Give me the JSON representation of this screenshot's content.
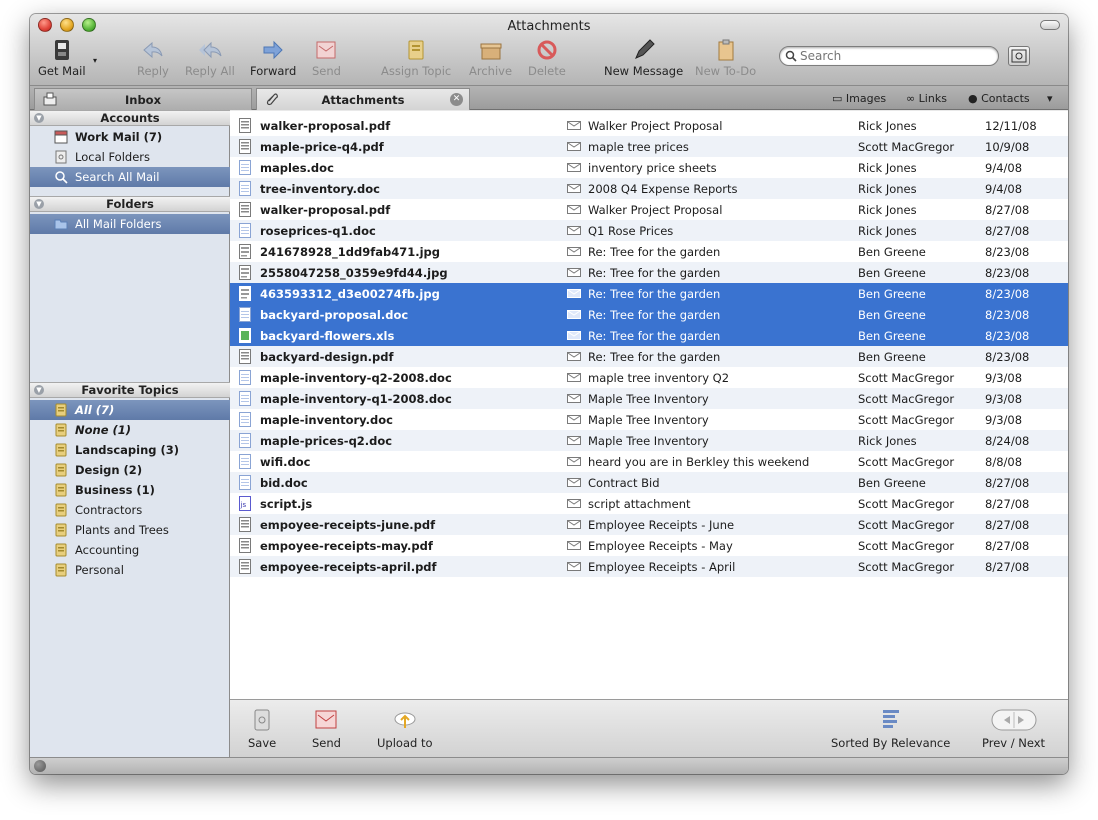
{
  "window": {
    "title": "Attachments"
  },
  "toolbar": {
    "get_mail": "Get Mail",
    "reply": "Reply",
    "reply_all": "Reply All",
    "forward": "Forward",
    "send": "Send",
    "assign_topic": "Assign Topic",
    "archive": "Archive",
    "delete": "Delete",
    "new_message": "New Message",
    "new_todo": "New To-Do",
    "search_placeholder": "Search"
  },
  "tabs": {
    "inbox": "Inbox",
    "attachments": "Attachments",
    "images": "Images",
    "links": "Links",
    "contacts": "Contacts"
  },
  "sidebar": {
    "accounts_header": "Accounts",
    "accounts": [
      {
        "label": "Work Mail (7)",
        "icon": "mailbox-icon"
      },
      {
        "label": "Local Folders",
        "icon": "local-folders-icon"
      },
      {
        "label": "Search All Mail",
        "icon": "search-icon"
      }
    ],
    "folders_header": "Folders",
    "folders": [
      {
        "label": "All Mail Folders",
        "icon": "folder-icon"
      }
    ],
    "topics_header": "Favorite Topics",
    "topics": [
      {
        "label": "All (7)"
      },
      {
        "label": "None (1)"
      },
      {
        "label": "Landscaping (3)"
      },
      {
        "label": "Design (2)"
      },
      {
        "label": "Business (1)"
      },
      {
        "label": "Contractors"
      },
      {
        "label": "Plants and Trees"
      },
      {
        "label": "Accounting"
      },
      {
        "label": "Personal"
      }
    ]
  },
  "attachments": [
    {
      "file": "walker-proposal.pdf",
      "subject": "Walker Project Proposal",
      "from": "Rick Jones",
      "date": "12/11/08",
      "type": "pdf"
    },
    {
      "file": "maple-price-q4.pdf",
      "subject": "maple tree prices",
      "from": "Scott MacGregor",
      "date": "10/9/08",
      "type": "pdf"
    },
    {
      "file": "maples.doc",
      "subject": "inventory price sheets",
      "from": "Rick Jones",
      "date": "9/4/08",
      "type": "doc"
    },
    {
      "file": "tree-inventory.doc",
      "subject": "2008 Q4 Expense Reports",
      "from": "Rick Jones",
      "date": "9/4/08",
      "type": "doc"
    },
    {
      "file": "walker-proposal.pdf",
      "subject": "Walker Project Proposal",
      "from": "Rick Jones",
      "date": "8/27/08",
      "type": "pdf"
    },
    {
      "file": "roseprices-q1.doc",
      "subject": "Q1 Rose Prices",
      "from": "Rick Jones",
      "date": "8/27/08",
      "type": "doc"
    },
    {
      "file": "241678928_1dd9fab471.jpg",
      "subject": "Re: Tree for the garden",
      "from": "Ben Greene",
      "date": "8/23/08",
      "type": "jpg"
    },
    {
      "file": "2558047258_0359e9fd44.jpg",
      "subject": "Re: Tree for the garden",
      "from": "Ben Greene",
      "date": "8/23/08",
      "type": "jpg"
    },
    {
      "file": "463593312_d3e00274fb.jpg",
      "subject": "Re: Tree for the garden",
      "from": "Ben Greene",
      "date": "8/23/08",
      "type": "jpg"
    },
    {
      "file": "backyard-proposal.doc",
      "subject": "Re: Tree for the garden",
      "from": "Ben Greene",
      "date": "8/23/08",
      "type": "doc"
    },
    {
      "file": "backyard-flowers.xls",
      "subject": "Re: Tree for the garden",
      "from": "Ben Greene",
      "date": "8/23/08",
      "type": "xls"
    },
    {
      "file": "backyard-design.pdf",
      "subject": "Re: Tree for the garden",
      "from": "Ben Greene",
      "date": "8/23/08",
      "type": "pdf"
    },
    {
      "file": "maple-inventory-q2-2008.doc",
      "subject": "maple tree inventory Q2",
      "from": "Scott MacGregor",
      "date": "9/3/08",
      "type": "doc"
    },
    {
      "file": "maple-inventory-q1-2008.doc",
      "subject": "Maple Tree Inventory",
      "from": "Scott MacGregor",
      "date": "9/3/08",
      "type": "doc"
    },
    {
      "file": "maple-inventory.doc",
      "subject": "Maple Tree Inventory",
      "from": "Scott MacGregor",
      "date": "9/3/08",
      "type": "doc"
    },
    {
      "file": "maple-prices-q2.doc",
      "subject": "Maple Tree Inventory",
      "from": "Rick Jones",
      "date": "8/24/08",
      "type": "doc"
    },
    {
      "file": "wifi.doc",
      "subject": "heard you are in Berkley this weekend",
      "from": "Scott MacGregor",
      "date": "8/8/08",
      "type": "doc"
    },
    {
      "file": "bid.doc",
      "subject": "Contract Bid",
      "from": "Ben Greene",
      "date": "8/27/08",
      "type": "doc"
    },
    {
      "file": "script.js",
      "subject": "script attachment",
      "from": "Scott MacGregor",
      "date": "8/27/08",
      "type": "js"
    },
    {
      "file": "empoyee-receipts-june.pdf",
      "subject": "Employee Receipts - June",
      "from": "Scott MacGregor",
      "date": "8/27/08",
      "type": "pdf"
    },
    {
      "file": "empoyee-receipts-may.pdf",
      "subject": "Employee Receipts - May",
      "from": "Scott MacGregor",
      "date": "8/27/08",
      "type": "pdf"
    },
    {
      "file": "empoyee-receipts-april.pdf",
      "subject": "Employee Receipts - April",
      "from": "Scott MacGregor",
      "date": "8/27/08",
      "type": "pdf"
    }
  ],
  "selected_rows": [
    8,
    9,
    10
  ],
  "bottom": {
    "save": "Save",
    "send": "Send",
    "upload": "Upload to",
    "sort": "Sorted By Relevance",
    "prev_next": "Prev / Next"
  },
  "colors": {
    "selection": "#3a73d0",
    "sidebar_selection": "#6580ad",
    "sidebar_bg": "#dfe5ee"
  }
}
